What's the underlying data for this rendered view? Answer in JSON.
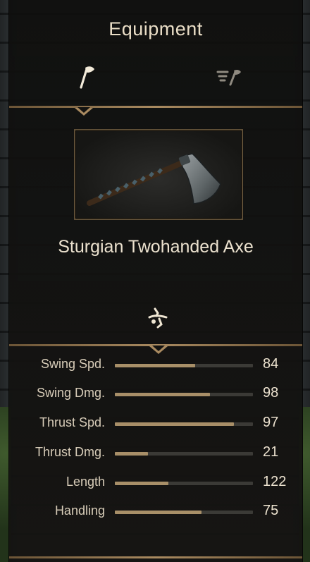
{
  "panel": {
    "title": "Equipment",
    "tabs": [
      {
        "icon": "axe-icon",
        "active": true
      },
      {
        "icon": "equipment-list-icon",
        "active": false
      }
    ]
  },
  "item": {
    "name": "Sturgian Twohanded Axe",
    "image": "two-handed-axe-image"
  },
  "stance": {
    "icon": "two-handed-stance-icon"
  },
  "stats": [
    {
      "label": "Swing Spd.",
      "value": "84",
      "fill": 0.58
    },
    {
      "label": "Swing Dmg.",
      "value": "98",
      "fill": 0.69
    },
    {
      "label": "Thrust Spd.",
      "value": "97",
      "fill": 0.86
    },
    {
      "label": "Thrust Dmg.",
      "value": "21",
      "fill": 0.24
    },
    {
      "label": "Length",
      "value": "122",
      "fill": 0.39
    },
    {
      "label": "Handling",
      "value": "75",
      "fill": 0.63
    }
  ],
  "colors": {
    "accent": "#a98a60",
    "bar_fill": "#a88f68",
    "bar_track": "#3b3a36",
    "text": "#ece2cf"
  }
}
